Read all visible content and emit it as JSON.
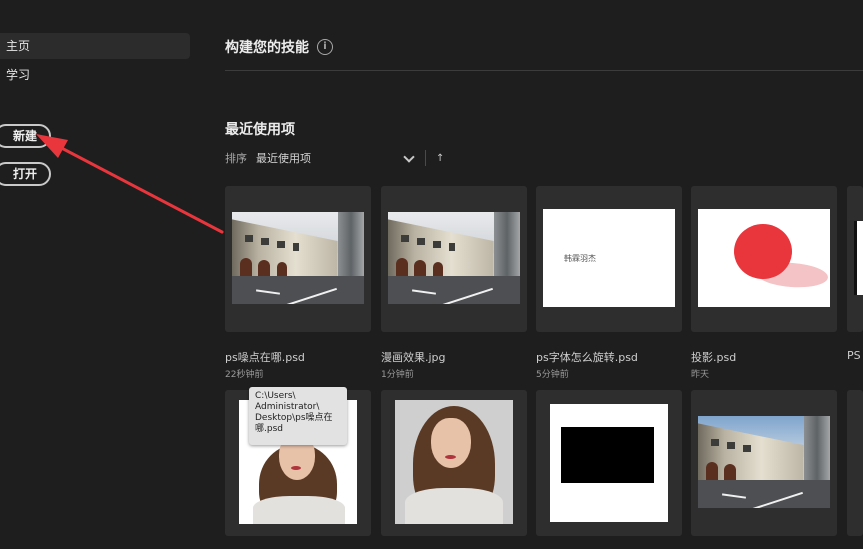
{
  "sidebar": {
    "home_label": "主页",
    "learn_label": "学习",
    "new_label": "新建",
    "open_label": "打开"
  },
  "main": {
    "title": "构建您的技能",
    "info_icon": "info-icon",
    "recent_title": "最近使用项",
    "sort_label": "排序",
    "sort_value": "最近使用项",
    "sort_direction": "↑"
  },
  "annotation": {
    "arrow_color": "#e8363c"
  },
  "cards": [
    {
      "name": "ps噪点在哪.psd",
      "time": "22秒钟前",
      "thumb": "street-photo"
    },
    {
      "name": "漫画效果.jpg",
      "time": "1分钟前",
      "thumb": "street-photo"
    },
    {
      "name": "ps字体怎么旋转.psd",
      "time": "5分钟前",
      "thumb": "rotated-text",
      "thumb_text": "韩霖羽杰"
    },
    {
      "name": "投影.psd",
      "time": "昨天",
      "thumb": "red-circle-shadow"
    },
    {
      "name": "PS",
      "time": "",
      "thumb": "partial"
    },
    {
      "name": "",
      "time": "",
      "thumb": "portrait-white-bg"
    },
    {
      "name": "",
      "time": "",
      "thumb": "portrait-gray-bg"
    },
    {
      "name": "",
      "time": "",
      "thumb": "black-rectangle"
    },
    {
      "name": "",
      "time": "",
      "thumb": "street-photo"
    }
  ],
  "tooltip": {
    "path": "C:\\Users\\ Administrator\\ Desktop\\ps噪点在哪.psd"
  },
  "colors": {
    "background": "#1e1e1e",
    "card": "#2e2e2e",
    "shape_red": "#e8363c"
  }
}
